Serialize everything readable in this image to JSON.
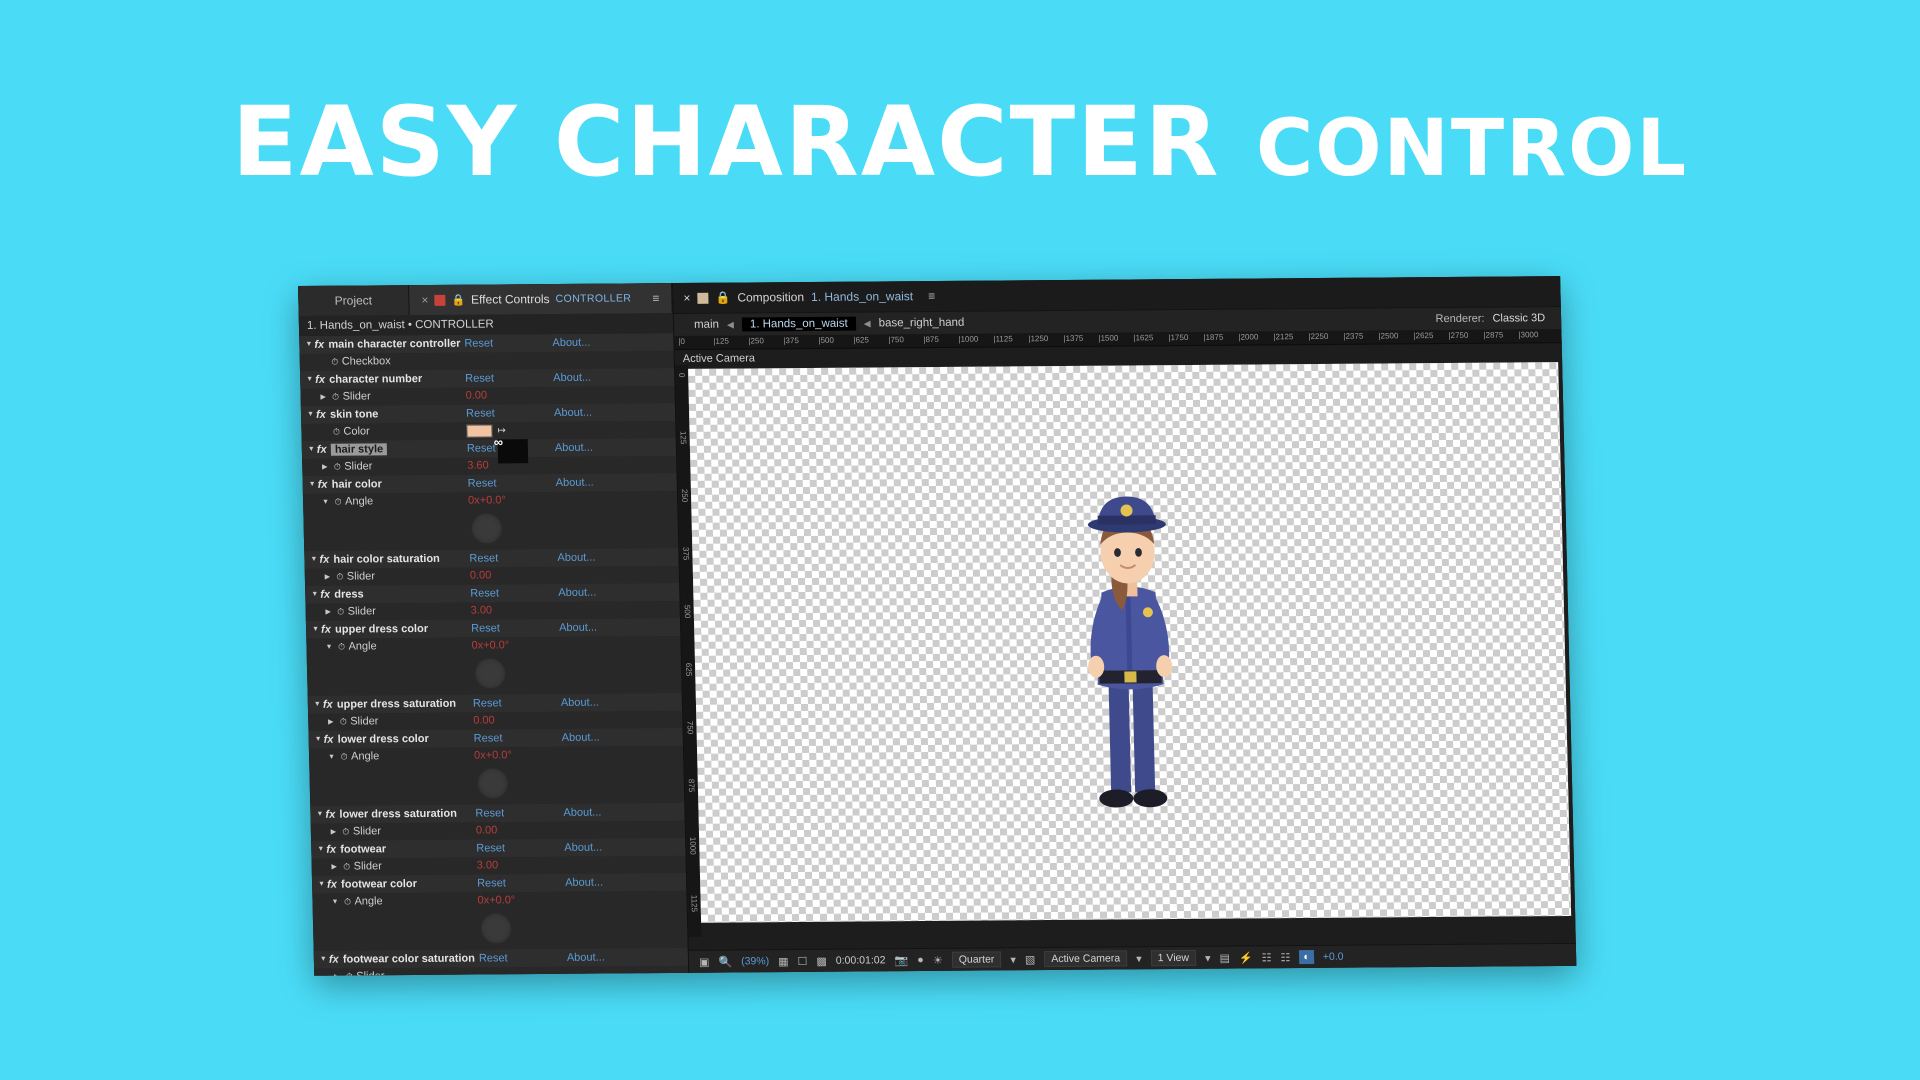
{
  "headline": {
    "part1": "EASY CHARACTER",
    "part2": "CONTROL"
  },
  "colors": {
    "background": "#4adcf7",
    "headline": "#ffffff",
    "panel_bg": "#232323",
    "accent_blue": "#5b9bd5",
    "value_red": "#b83b3b",
    "skin_swatch": "#f2c3a0"
  },
  "effect_controls": {
    "tabs": {
      "project_label": "Project",
      "close_icon": "×",
      "lock_icon": "lock",
      "title": "Effect Controls",
      "subtitle": "CONTROLLER",
      "menu_icon": "≡"
    },
    "comp_layer_line": "1. Hands_on_waist • CONTROLLER",
    "reset_label": "Reset",
    "about_label": "About...",
    "effects": [
      {
        "name": "main character controller",
        "reset": "Reset",
        "about": "About...",
        "params": [
          {
            "name": "Checkbox",
            "type": "checkbox",
            "value": ""
          }
        ]
      },
      {
        "name": "character number",
        "reset": "Reset",
        "about": "About...",
        "params": [
          {
            "name": "Slider",
            "type": "slider",
            "value": "0.00"
          }
        ]
      },
      {
        "name": "skin tone",
        "reset": "Reset",
        "about": "About...",
        "params": [
          {
            "name": "Color",
            "type": "color",
            "value": "#f2c3a0"
          }
        ]
      },
      {
        "name": "hair style",
        "selected": true,
        "reset": "Reset",
        "about": "About...",
        "params": [
          {
            "name": "Slider",
            "type": "slider",
            "value": "3.60"
          }
        ]
      },
      {
        "name": "hair color",
        "reset": "Reset",
        "about": "About...",
        "params": [
          {
            "name": "Angle",
            "type": "angle",
            "value": "0x+0.0°"
          }
        ]
      },
      {
        "name": "hair color saturation",
        "reset": "Reset",
        "about": "About...",
        "params": [
          {
            "name": "Slider",
            "type": "slider",
            "value": "0.00"
          }
        ]
      },
      {
        "name": "dress",
        "reset": "Reset",
        "about": "About...",
        "params": [
          {
            "name": "Slider",
            "type": "slider",
            "value": "3.00"
          }
        ]
      },
      {
        "name": "upper dress color",
        "reset": "Reset",
        "about": "About...",
        "params": [
          {
            "name": "Angle",
            "type": "angle",
            "value": "0x+0.0°"
          }
        ]
      },
      {
        "name": "upper dress saturation",
        "reset": "Reset",
        "about": "About...",
        "params": [
          {
            "name": "Slider",
            "type": "slider",
            "value": "0.00"
          }
        ]
      },
      {
        "name": "lower dress color",
        "reset": "Reset",
        "about": "About...",
        "params": [
          {
            "name": "Angle",
            "type": "angle",
            "value": "0x+0.0°"
          }
        ]
      },
      {
        "name": "lower dress saturation",
        "reset": "Reset",
        "about": "About...",
        "params": [
          {
            "name": "Slider",
            "type": "slider",
            "value": "0.00"
          }
        ]
      },
      {
        "name": "footwear",
        "reset": "Reset",
        "about": "About...",
        "params": [
          {
            "name": "Slider",
            "type": "slider",
            "value": "3.00"
          }
        ]
      },
      {
        "name": "footwear color",
        "reset": "Reset",
        "about": "About...",
        "params": [
          {
            "name": "Angle",
            "type": "angle",
            "value": "0x+0.0°"
          }
        ]
      },
      {
        "name": "footwear color saturation",
        "reset": "Reset",
        "about": "About...",
        "params": [
          {
            "name": "Slider",
            "type": "slider",
            "value": ""
          }
        ]
      }
    ]
  },
  "composition": {
    "tab": {
      "close_icon": "×",
      "lock_icon": "lock",
      "title": "Composition",
      "comp_name": "1. Hands_on_waist",
      "menu_icon": "≡"
    },
    "breadcrumb": {
      "root": "main",
      "current": "1. Hands_on_waist",
      "child": "base_right_hand",
      "arrow": "◀"
    },
    "renderer": {
      "label": "Renderer:",
      "value": "Classic 3D"
    },
    "ruler_ticks": [
      "0",
      "125",
      "250",
      "375",
      "500",
      "625",
      "750",
      "875",
      "1000",
      "1125",
      "1250",
      "1375",
      "1500",
      "1625",
      "1750",
      "1875",
      "2000",
      "2125",
      "2250",
      "2375",
      "2500",
      "2625",
      "2750",
      "2875",
      "3000"
    ],
    "vruler_ticks": [
      "0",
      "125",
      "250",
      "375",
      "500",
      "625",
      "750",
      "875",
      "1000",
      "1125"
    ],
    "view_label": "Active Camera",
    "bottom_bar": {
      "zoom": "(39%)",
      "timecode": "0:00:01:02",
      "quality": "Quarter",
      "camera": "Active Camera",
      "views": "1 View",
      "exposure": "+0.0"
    }
  }
}
